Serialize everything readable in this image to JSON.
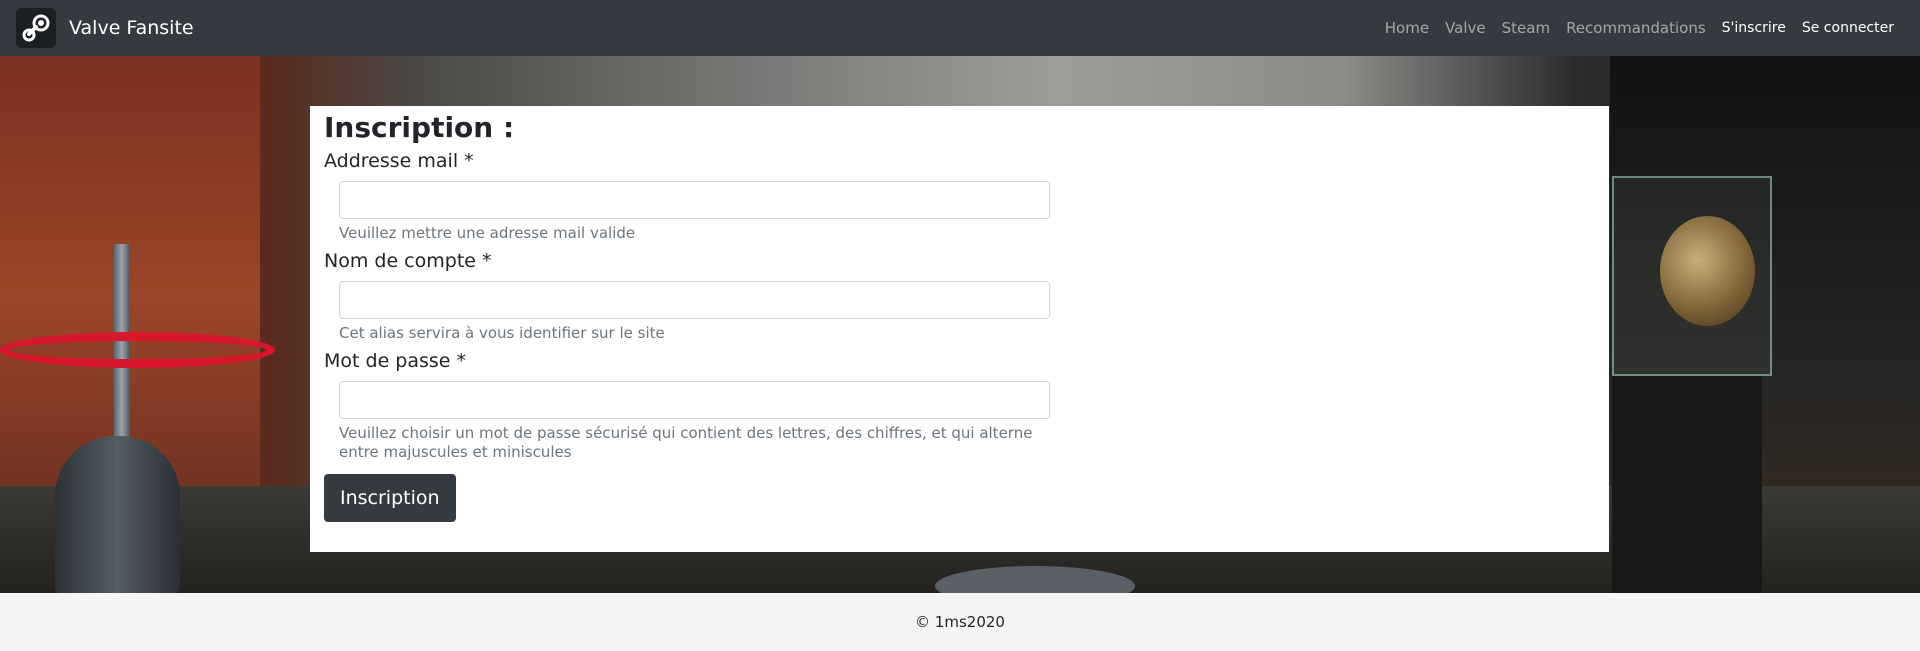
{
  "navbar": {
    "brand_name": "Valve Fansite",
    "brand_logo_icon": "steam-logo-icon",
    "links": [
      {
        "label": "Home",
        "active": false
      },
      {
        "label": "Valve",
        "active": false
      },
      {
        "label": "Steam",
        "active": false
      },
      {
        "label": "Recommandations",
        "active": false
      },
      {
        "label": "S'inscrire",
        "active": true
      },
      {
        "label": "Se connecter",
        "active": true
      }
    ]
  },
  "form": {
    "title": "Inscription :",
    "fields": [
      {
        "label": "Addresse mail *",
        "value": "",
        "placeholder": "",
        "help": "Veuillez mettre une adresse mail valide"
      },
      {
        "label": "Nom de compte *",
        "value": "",
        "placeholder": "",
        "help": "Cet alias servira à vous identifier sur le site"
      },
      {
        "label": "Mot de passe *",
        "value": "",
        "placeholder": "",
        "help": "Veuillez choisir un mot de passe sécurisé qui contient des lettres, des chiffres, et qui alterne entre majuscules et miniscules"
      }
    ],
    "submit_label": "Inscription"
  },
  "footer": {
    "copyright": "© 1ms2020"
  },
  "colors": {
    "navbar_bg": "#343a40",
    "button_bg": "#343a40",
    "help_text": "#6c757d",
    "footer_bg": "#f5f5f5"
  }
}
